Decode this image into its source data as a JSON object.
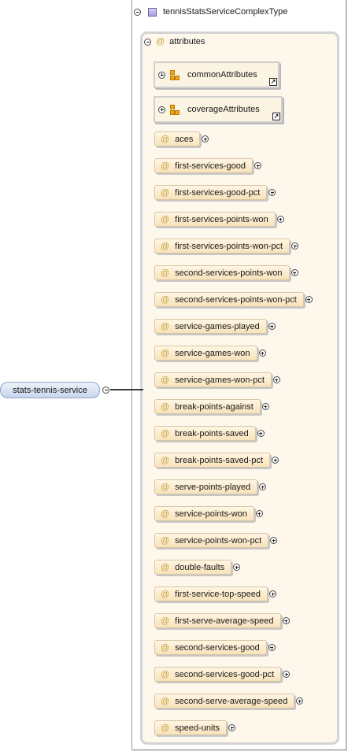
{
  "element": {
    "name": "stats-tennis-service"
  },
  "complex_type": {
    "name": "tennisStatsServiceComplexType"
  },
  "attribute_group": {
    "label": "attributes",
    "symbol": "@",
    "groups": [
      {
        "name": "commonAttributes",
        "link_symbol": "↗"
      },
      {
        "name": "coverageAttributes",
        "link_symbol": "↗"
      }
    ],
    "attributes": [
      "aces",
      "first-services-good",
      "first-services-good-pct",
      "first-services-points-won",
      "first-services-points-won-pct",
      "second-services-points-won",
      "second-services-points-won-pct",
      "service-games-played",
      "service-games-won",
      "service-games-won-pct",
      "break-points-against",
      "break-points-saved",
      "break-points-saved-pct",
      "serve-points-played",
      "service-points-won",
      "service-points-won-pct",
      "double-faults",
      "first-service-top-speed",
      "first-serve-average-speed",
      "second-services-good",
      "second-services-good-pct",
      "second-serve-average-speed",
      "speed-units"
    ]
  },
  "colors": {
    "attribute_fill": "#f7e2bb",
    "attribute_group_fill": "#fdf7ec",
    "element_fill": "#c7d5ee",
    "at_symbol": "#c9a23e",
    "type_icon": "#a99ce0",
    "group_icon": "#f0a81a"
  }
}
